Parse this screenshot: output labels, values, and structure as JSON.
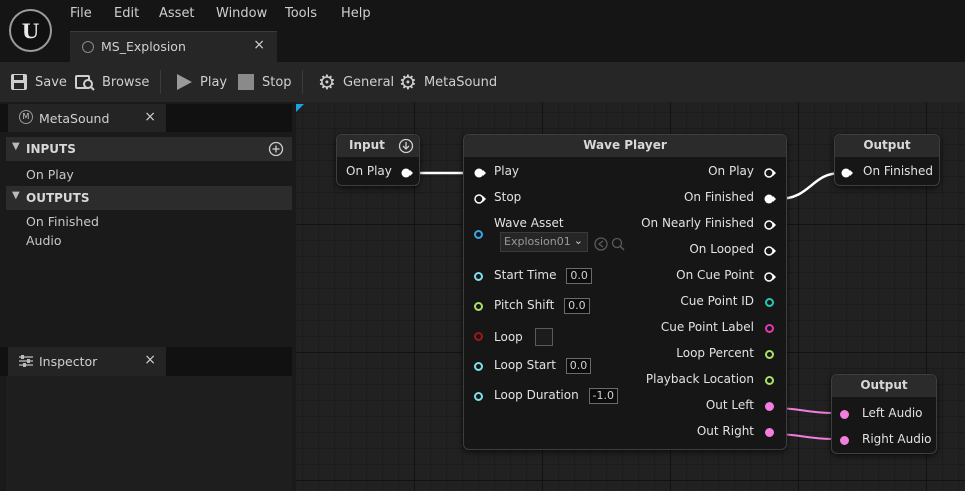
{
  "menu": [
    "File",
    "Edit",
    "Asset",
    "Window",
    "Tools",
    "Help"
  ],
  "document_tab": {
    "label": "MS_Explosion",
    "close": "×"
  },
  "toolbar": {
    "save": "Save",
    "browse": "Browse",
    "play": "Play",
    "stop": "Stop",
    "general": "General",
    "metasound": "MetaSound"
  },
  "metasound_panel": {
    "tab": "MetaSound",
    "close": "×",
    "inputs_header": "INPUTS",
    "inputs": [
      "On Play"
    ],
    "outputs_header": "OUTPUTS",
    "outputs": [
      "On Finished",
      "Audio"
    ]
  },
  "inspector_panel": {
    "tab": "Inspector",
    "close": "×"
  },
  "nodes": {
    "input": {
      "title": "Input",
      "pin": "On Play"
    },
    "wave_player": {
      "title": "Wave Player",
      "inputs": {
        "play": "Play",
        "stop": "Stop",
        "wave_asset": "Wave Asset",
        "wave_asset_value": "Explosion01",
        "start_time": "Start Time",
        "start_time_value": "0.0",
        "pitch_shift": "Pitch Shift",
        "pitch_shift_value": "0.0",
        "loop": "Loop",
        "loop_start": "Loop Start",
        "loop_start_value": "0.0",
        "loop_duration": "Loop Duration",
        "loop_duration_value": "-1.0"
      },
      "outputs": {
        "on_play": "On Play",
        "on_finished": "On Finished",
        "on_nearly_finished": "On Nearly Finished",
        "on_looped": "On Looped",
        "on_cue_point": "On Cue Point",
        "cue_point_id": "Cue Point ID",
        "cue_point_label": "Cue Point Label",
        "loop_percent": "Loop Percent",
        "playback_location": "Playback Location",
        "out_left": "Out Left",
        "out_right": "Out Right"
      }
    },
    "output_finished": {
      "title": "Output",
      "pin": "On Finished"
    },
    "output_audio": {
      "title": "Output",
      "left": "Left Audio",
      "right": "Right Audio"
    }
  },
  "colors": {
    "exec": "#ffffff",
    "time": "#7ee0ea",
    "float": "#a8e06a",
    "bool": "#a01818",
    "int": "#28c8b0",
    "string": "#e03ab0",
    "audio": "#f27ede",
    "wave": "#3aa6e8"
  }
}
